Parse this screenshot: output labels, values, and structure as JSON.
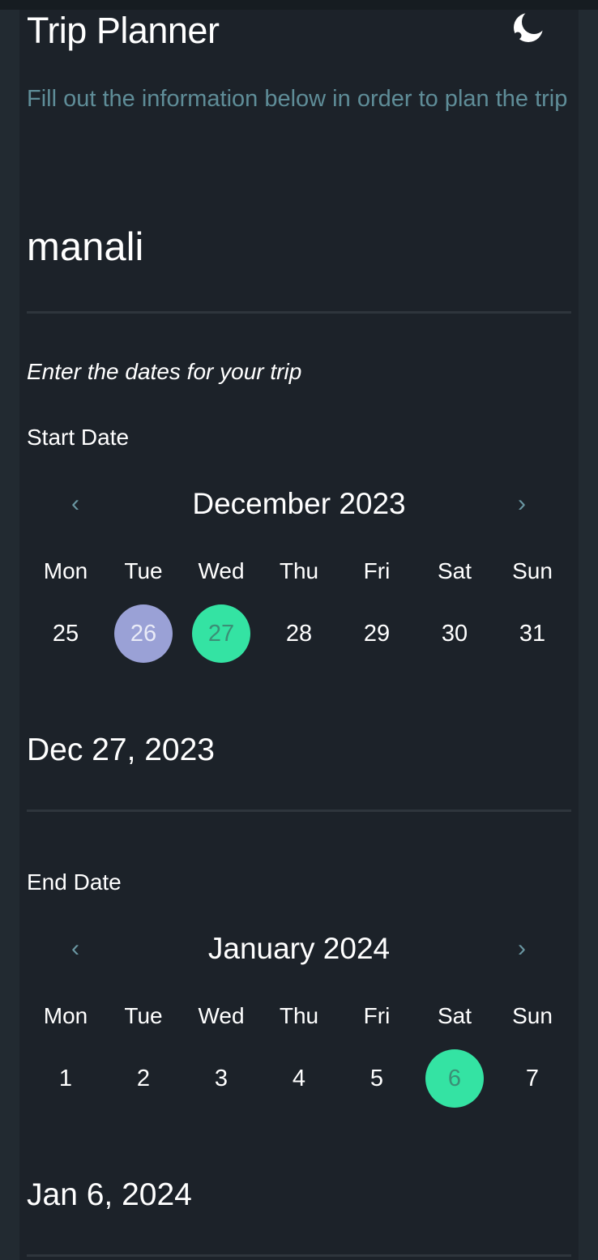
{
  "header": {
    "title": "Trip Planner",
    "theme_icon": "moon-icon"
  },
  "intro": {
    "subtitle": "Fill out the information below in order to plan the trip"
  },
  "destination": {
    "value": "manali"
  },
  "dates": {
    "hint": "Enter the dates for your trip"
  },
  "start": {
    "label": "Start Date",
    "month": "December 2023",
    "prev_icon": "chevron-left-icon",
    "next_icon": "chevron-right-icon",
    "weekdays": [
      "Mon",
      "Tue",
      "Wed",
      "Thu",
      "Fri",
      "Sat",
      "Sun"
    ],
    "days": [
      "25",
      "26",
      "27",
      "28",
      "29",
      "30",
      "31"
    ],
    "today": "26",
    "selected": "27",
    "selected_display": "Dec 27, 2023"
  },
  "end": {
    "label": "End Date",
    "month": "January 2024",
    "prev_icon": "chevron-left-icon",
    "next_icon": "chevron-right-icon",
    "weekdays": [
      "Mon",
      "Tue",
      "Wed",
      "Thu",
      "Fri",
      "Sat",
      "Sun"
    ],
    "days": [
      "1",
      "2",
      "3",
      "4",
      "5",
      "6",
      "7"
    ],
    "selected": "6",
    "selected_display": "Jan 6, 2024"
  },
  "colors": {
    "background": "#1c2229",
    "accent_selected": "#34e3a3",
    "accent_today": "#9aa1d6",
    "subtitle_text": "#5f8d98"
  }
}
